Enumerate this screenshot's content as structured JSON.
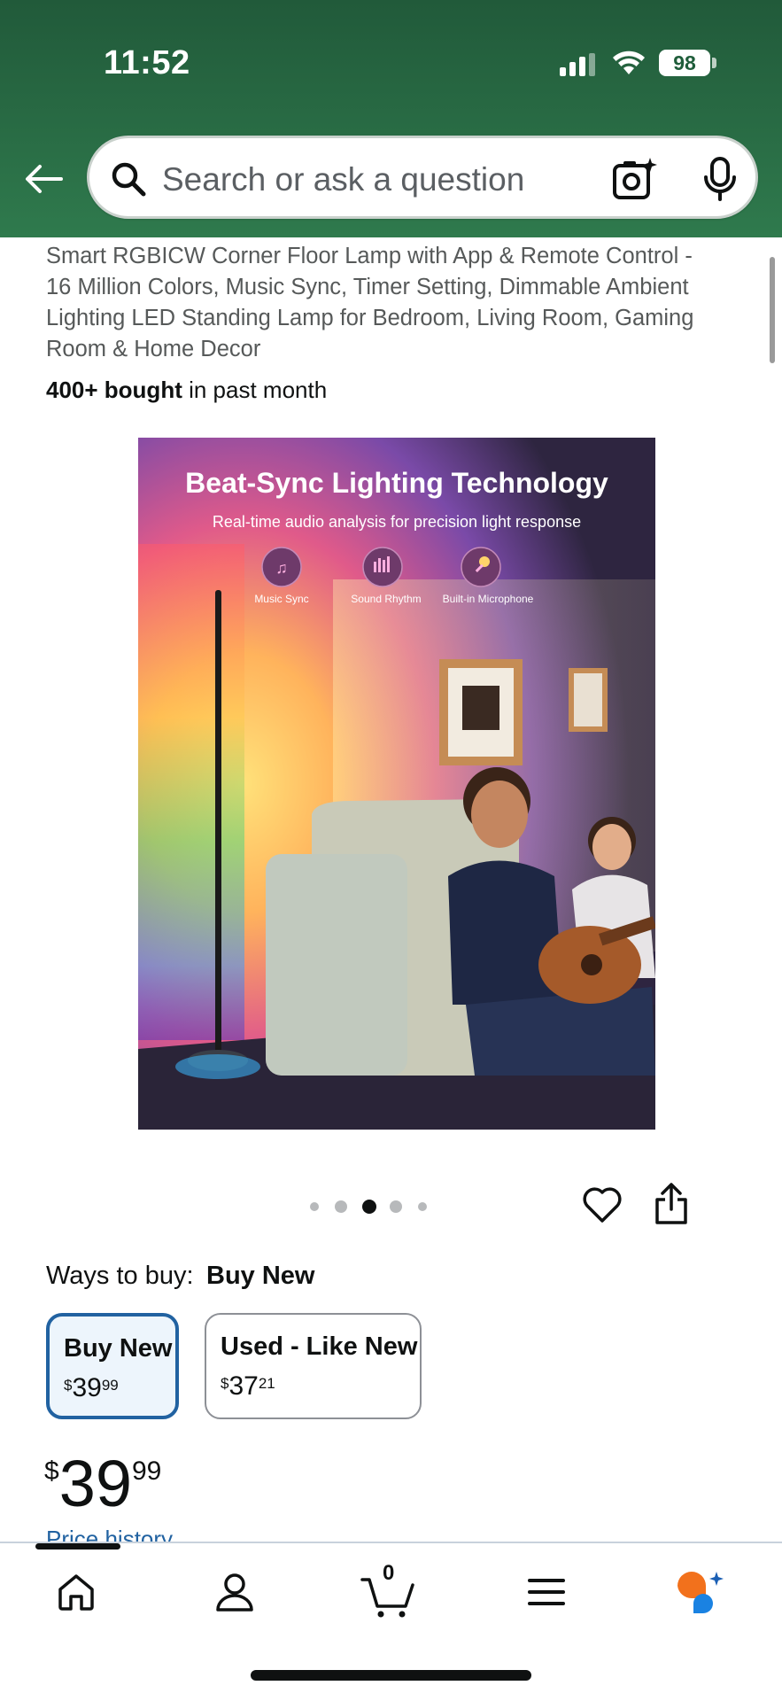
{
  "status_bar": {
    "time": "11:52",
    "battery": "98"
  },
  "search": {
    "placeholder": "Search or ask a question"
  },
  "product": {
    "title": "Smart RGBICW Corner Floor Lamp with App & Remote Control - 16 Million Colors, Music Sync, Timer Setting, Dimmable Ambient Lighting LED Standing Lamp for Bedroom, Living Room, Gaming Room & Home Decor",
    "bought_bold": "400+ bought",
    "bought_rest": " in past month",
    "image": {
      "headline": "Beat-Sync Lighting Technology",
      "subheadline": "Real-time audio analysis for precision light response",
      "features": [
        "Music Sync",
        "Sound Rhythm",
        "Built-in Microphone"
      ]
    },
    "image_carousel": {
      "count": 5,
      "active_index": 2
    }
  },
  "ways_to_buy": {
    "label": "Ways to buy:",
    "selected": "Buy New",
    "options": [
      {
        "label": "Buy New",
        "currency": "$",
        "dollars": "39",
        "cents": "99"
      },
      {
        "label": "Used - Like New",
        "currency": "$",
        "dollars": "37",
        "cents": "21"
      }
    ]
  },
  "price": {
    "currency": "$",
    "dollars": "39",
    "cents": "99"
  },
  "price_history_link": "Price history",
  "bottom_nav": {
    "items": [
      "home-icon",
      "account-icon",
      "cart-icon",
      "menu-icon",
      "rufus-icon"
    ],
    "cart_count": "0"
  },
  "colors": {
    "header": "#215a3a",
    "link": "#2162a1",
    "selected_border": "#2162a1",
    "rufus_orange": "#f2711c",
    "rufus_blue": "#1a82e2"
  }
}
